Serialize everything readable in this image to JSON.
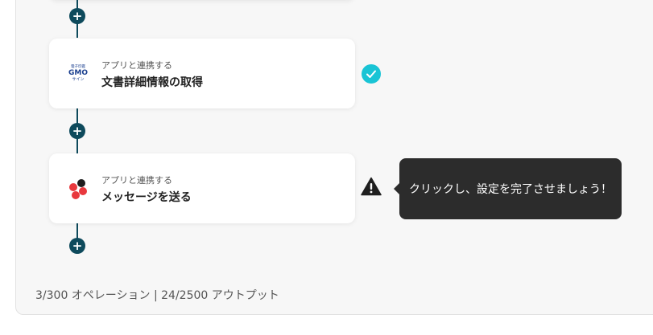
{
  "flow": {
    "add_step_glyph": "+",
    "steps": [
      {
        "subtitle": "アプリと連携する",
        "title": "文書詳細情報の取得",
        "app_logo": {
          "icon": "gmo-sign-logo",
          "tagline": "電子印鑑",
          "brand": "GMO",
          "product": "サイン",
          "color": "#1a3f8f"
        },
        "status": "completed",
        "status_icon": "check-icon"
      },
      {
        "subtitle": "アプリと連携する",
        "title": "メッセージを送る",
        "app_logo": {
          "icon": "chatwork-logo",
          "colors": [
            "#e8383d",
            "#1d1d1d"
          ]
        },
        "status": "incomplete",
        "status_icon": "warning-icon"
      }
    ]
  },
  "tooltip": {
    "text": "クリックし、設定を完了させましょう！"
  },
  "usage": {
    "text": "3/300 オペレーション | 24/2500 アウトプット"
  },
  "colors": {
    "connector": "#0e4a5c",
    "check": "#19c4d5",
    "tooltip_bg": "#2c2c2c",
    "canvas_bg": "#f7f7f7"
  }
}
